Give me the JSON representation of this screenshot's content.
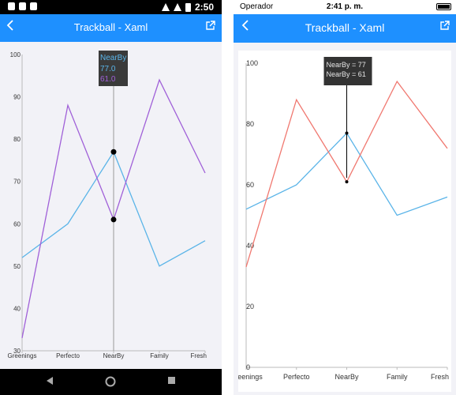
{
  "android": {
    "status_time": "2:50",
    "title": "Trackball - Xaml",
    "chart_data": {
      "type": "line",
      "categories": [
        "Greenings",
        "Perfecto",
        "NearBy",
        "Family",
        "Fresh"
      ],
      "y_ticks": [
        "100",
        "90",
        "80",
        "70",
        "60",
        "50",
        "40",
        "30"
      ],
      "ylim": [
        30,
        100
      ],
      "series": [
        {
          "values": [
            52,
            60,
            77,
            50,
            56
          ],
          "color": "#5ab4e8"
        },
        {
          "values": [
            33,
            88,
            61,
            94,
            72
          ],
          "color": "#a060d8"
        }
      ],
      "trackball": {
        "category": "NearBy",
        "title": "NearBy",
        "values": [
          "77.0",
          "61.0"
        ]
      }
    }
  },
  "ios": {
    "carrier": "Operador",
    "status_time": "2:41 p. m.",
    "title": "Trackball - Xaml",
    "chart_data": {
      "type": "line",
      "categories": [
        "Greenings",
        "Perfecto",
        "NearBy",
        "Family",
        "Fresh"
      ],
      "y_ticks": [
        "100",
        "80",
        "60",
        "40",
        "20",
        "0"
      ],
      "ylim": [
        0,
        100
      ],
      "series": [
        {
          "values": [
            52,
            60,
            77,
            50,
            56
          ],
          "color": "#5ab4e8"
        },
        {
          "values": [
            33,
            88,
            61,
            94,
            72
          ],
          "color": "#f07870"
        }
      ],
      "trackball": {
        "category": "NearBy",
        "lines": [
          "NearBy = 77",
          "NearBy = 61"
        ]
      }
    }
  }
}
